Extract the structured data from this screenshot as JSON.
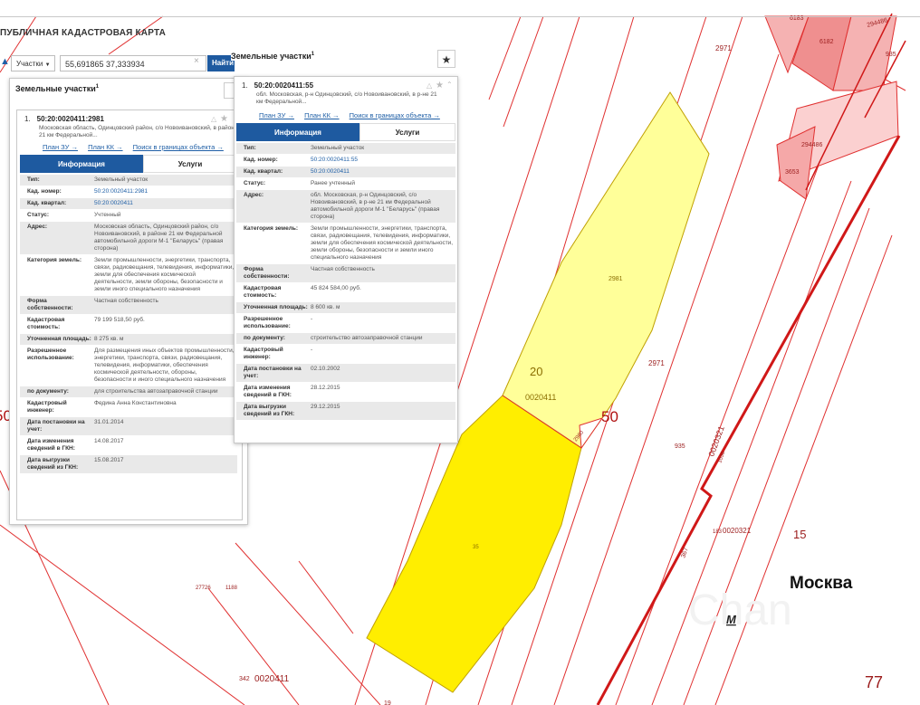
{
  "app": {
    "title": "ПУБЛИЧНАЯ КАДАСТРОВАЯ КАРТА"
  },
  "search": {
    "type_label": "Участки",
    "query": "55,691865 37,333934",
    "find_label": "Найти"
  },
  "panel_left": {
    "header": "Земельные участки",
    "header_sup": "1",
    "item": {
      "index": "1.",
      "number": "50:20:0020411:2981",
      "address": "Московская область, Одинцовский район, с/о Новоивановский, в районе 21 км Федеральной...",
      "links": [
        "План ЗУ →",
        "План КК →",
        "Поиск в границах объекта →"
      ],
      "tabs": [
        "Информация",
        "Услуги"
      ],
      "rows": [
        {
          "k": "Тип:",
          "v": "Земельный участок"
        },
        {
          "k": "Кад. номер:",
          "v": "50:20:0020411:2981",
          "link": true
        },
        {
          "k": "Кад. квартал:",
          "v": "50:20:0020411",
          "link": true
        },
        {
          "k": "Статус:",
          "v": "Учтенный"
        },
        {
          "k": "Адрес:",
          "v": "Московская область, Одинцовский район, с/о Новоивановский, в районе 21 км Федеральной автомобильной дороги М-1 \"Беларусь\" (правая сторона)"
        },
        {
          "k": "Категория земель:",
          "v": "Земли промышленности, энергетики, транспорта, связи, радиовещания, телевидения, информатики, земли для обеспечения космической деятельности, земли обороны, безопасности и земли иного специального назначения"
        },
        {
          "k": "Форма собственности:",
          "v": "Частная собственность"
        },
        {
          "k": "Кадастровая стоимость:",
          "v": "79 199 518,50 руб."
        },
        {
          "k": "Уточненная площадь:",
          "v": "8 275 кв. м"
        },
        {
          "k": "Разрешенное использование:",
          "v": "Для размещения иных объектов промышленности, энергетики, транспорта, связи, радиовещания, телевидения, информатики, обеспечения космической деятельности, обороны, безопасности и иного специального назначения"
        },
        {
          "k": "по документу:",
          "v": "для строительства автозаправочной станции"
        },
        {
          "k": "Кадастровый инженер:",
          "v": "Федина Анна Константиновна"
        },
        {
          "k": "Дата постановки на учет:",
          "v": "31.01.2014"
        },
        {
          "k": "Дата изменения сведений в ГКН:",
          "v": "14.08.2017"
        },
        {
          "k": "Дата выгрузки сведений из ГКН:",
          "v": "15.08.2017"
        }
      ]
    }
  },
  "panel_right": {
    "header": "Земельные участки",
    "header_sup": "1",
    "item": {
      "index": "1.",
      "number": "50:20:0020411:55",
      "address": "обл. Московская, р-н Одинцовский, с/о Новоивановский, в р-не 21 км Федеральной...",
      "links": [
        "План ЗУ →",
        "План КК →",
        "Поиск в границах объекта →"
      ],
      "tabs": [
        "Информация",
        "Услуги"
      ],
      "rows": [
        {
          "k": "Тип:",
          "v": "Земельный участок"
        },
        {
          "k": "Кад. номер:",
          "v": "50:20:0020411:55",
          "link": true
        },
        {
          "k": "Кад. квартал:",
          "v": "50:20:0020411",
          "link": true
        },
        {
          "k": "Статус:",
          "v": "Ранее учтенный"
        },
        {
          "k": "Адрес:",
          "v": "обл. Московская, р-н Одинцовский, с/о Новоивановский, в р-не 21 км Федеральной автомобильной дороги М-1 \"Беларусь\" (правая сторона)"
        },
        {
          "k": "Категория земель:",
          "v": "Земли промышленности, энергетики, транспорта, связи, радиовещания, телевидения, информатики, земли для обеспечения космической деятельности, земли обороны, безопасности и земли иного специального назначения"
        },
        {
          "k": "Форма собственности:",
          "v": "Частная собственность"
        },
        {
          "k": "Кадастровая стоимость:",
          "v": "45 824 584,00 руб."
        },
        {
          "k": "Уточненная площадь:",
          "v": "8 600 кв. м"
        },
        {
          "k": "Разрешенное использование:",
          "v": "-"
        },
        {
          "k": "по документу:",
          "v": "строительство автозаправочной станции"
        },
        {
          "k": "Кадастровый инженер:",
          "v": "-"
        },
        {
          "k": "Дата постановки на учет:",
          "v": "02.10.2002"
        },
        {
          "k": "Дата изменения сведений в ГКН:",
          "v": "28.12.2015"
        },
        {
          "k": "Дата выгрузки сведений из ГКН:",
          "v": "29.12.2015"
        }
      ]
    }
  },
  "map": {
    "labels": {
      "l2971a": "2971",
      "l2971b": "2971",
      "l294486a": "294486",
      "l294486b": "294486",
      "l3653": "3653",
      "l935a": "935",
      "l935b": "935",
      "l6182": "6182",
      "l6183": "6183",
      "l2981": "2981",
      "l20": "20",
      "l0020411a": "0020411",
      "l2980": "2980",
      "l50": "50",
      "l0020321a": "0020321",
      "l1036": "1036",
      "l0020321b": "0020321",
      "l183": "183",
      "l367": "367",
      "l15": "15",
      "l35": "35",
      "l27726": "27726",
      "l1188": "1188",
      "l342": "342",
      "l0020411b": "0020411",
      "l19": "19",
      "l50left": "50",
      "moscow": "Москва",
      "metro": "М",
      "region77": "77"
    }
  },
  "colors": {
    "brand": "#1e5aa0",
    "boundary": "#d01818",
    "parcel_light": "#ffff99",
    "parcel_bright": "#ffee00",
    "pink": "#f5a8a8"
  }
}
